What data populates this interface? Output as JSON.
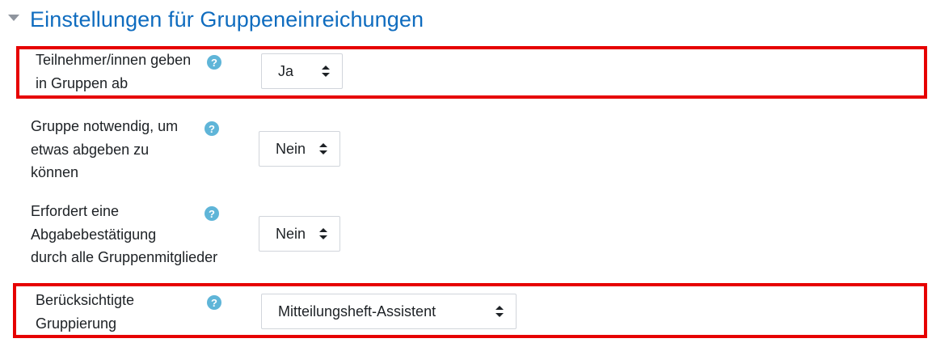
{
  "section": {
    "title": "Einstellungen für Gruppeneinreichungen",
    "collapse_icon": "caret-down-icon"
  },
  "accent_colors": {
    "title": "#0f6cbf",
    "highlight": "#e60000",
    "help_icon": "#5fb5d8"
  },
  "settings": [
    {
      "label_lines": [
        "Teilnehmer/innen geben",
        "in Gruppen ab"
      ],
      "value": "Ja",
      "highlighted": true
    },
    {
      "label_lines": [
        "Gruppe notwendig, um",
        "etwas abgeben zu",
        "können"
      ],
      "value": "Nein",
      "highlighted": false
    },
    {
      "label_lines": [
        "Erfordert eine",
        "Abgabebestätigung",
        "durch alle Gruppenmitglieder"
      ],
      "value": "Nein",
      "highlighted": false
    },
    {
      "label_lines": [
        "Berücksichtigte",
        "Gruppierung"
      ],
      "value": "Mitteilungsheft-Assistent",
      "highlighted": true
    }
  ],
  "help_icon_glyph": "?"
}
